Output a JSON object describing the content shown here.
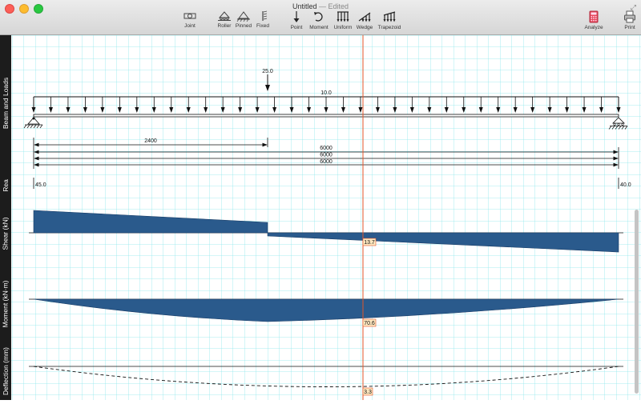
{
  "window": {
    "title": "Untitled",
    "edited": "— Edited"
  },
  "toolbar": {
    "joint": "Joint",
    "roller": "Roller",
    "pinned": "Pinned",
    "fixed": "Fixed",
    "point": "Point",
    "moment": "Moment",
    "uniform": "Uniform",
    "wedge": "Wedge",
    "trapezoid": "Trapezoid",
    "analyze": "Analyze",
    "print": "Print"
  },
  "sections": {
    "beam": "Beam and Loads",
    "reactions": "Rea",
    "shear": "Shear (kN)",
    "moment": "Moment (kN·m)",
    "deflection": "Deflection (mm)"
  },
  "loads": {
    "point_value": "25.0",
    "uniform_value": "10.0"
  },
  "dimensions": {
    "d1": "2400",
    "d2": "6000",
    "d3": "6000",
    "d4": "6000"
  },
  "reactions": {
    "left": "45.0",
    "right": "40.0"
  },
  "cursor_readouts": {
    "shear": "13.7",
    "moment": "70.6",
    "deflection": "3.3"
  },
  "colors": {
    "grid": "#8ee8ee",
    "diagram_fill": "#2a5a8c",
    "cursor_line": "#e0552a",
    "readout_bg": "#ffe8c0"
  }
}
